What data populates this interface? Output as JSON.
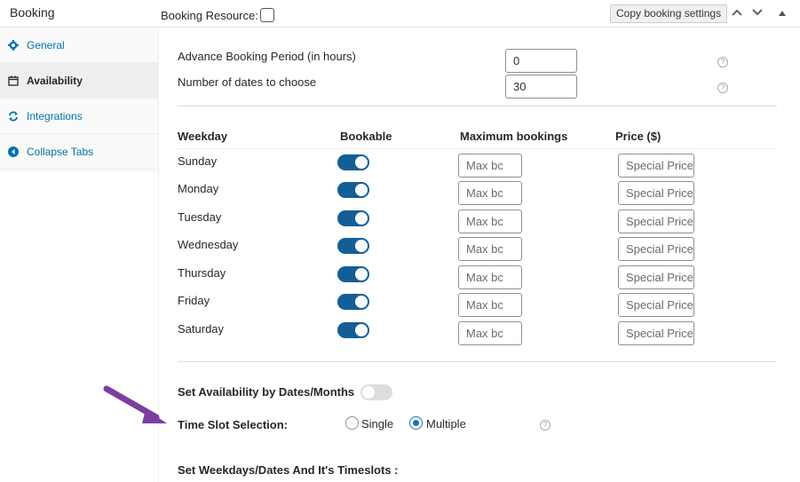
{
  "header": {
    "title": "Booking",
    "resource_label": "Booking Resource:",
    "copy_button": "Copy booking settings"
  },
  "sidebar": {
    "items": [
      {
        "label": "General",
        "icon": "gear-icon"
      },
      {
        "label": "Availability",
        "icon": "calendar-icon"
      },
      {
        "label": "Integrations",
        "icon": "sync-icon"
      },
      {
        "label": "Collapse Tabs",
        "icon": "collapse-arrow-icon"
      }
    ],
    "active": "Availability"
  },
  "availability": {
    "advance_label": "Advance Booking Period (in hours)",
    "advance_value": "0",
    "dates_label": "Number of dates to choose",
    "dates_value": "30"
  },
  "weekday_table": {
    "headers": [
      "Weekday",
      "Bookable",
      "Maximum bookings",
      "Price ($)"
    ],
    "rows": [
      {
        "day": "Sunday",
        "bookable": true,
        "max_placeholder": "Max bc",
        "price_placeholder": "Special Price"
      },
      {
        "day": "Monday",
        "bookable": true,
        "max_placeholder": "Max bc",
        "price_placeholder": "Special Price"
      },
      {
        "day": "Tuesday",
        "bookable": true,
        "max_placeholder": "Max bc",
        "price_placeholder": "Special Price"
      },
      {
        "day": "Wednesday",
        "bookable": true,
        "max_placeholder": "Max bc",
        "price_placeholder": "Special Price"
      },
      {
        "day": "Thursday",
        "bookable": true,
        "max_placeholder": "Max bc",
        "price_placeholder": "Special Price"
      },
      {
        "day": "Friday",
        "bookable": true,
        "max_placeholder": "Max bc",
        "price_placeholder": "Special Price"
      },
      {
        "day": "Saturday",
        "bookable": true,
        "max_placeholder": "Max bc",
        "price_placeholder": "Special Price"
      }
    ]
  },
  "options": {
    "dates_months_label": "Set Availability by Dates/Months",
    "dates_months_enabled": false,
    "timeslot_label": "Time Slot Selection:",
    "radio_single": "Single",
    "radio_multiple": "Multiple",
    "timeslot_selected": "Multiple",
    "weekdays_timeslots_label": "Set Weekdays/Dates And It's Timeslots :"
  },
  "colors": {
    "toggle_on": "#135e96",
    "link": "#0073aa",
    "annotation_arrow": "#7b3fa0"
  }
}
